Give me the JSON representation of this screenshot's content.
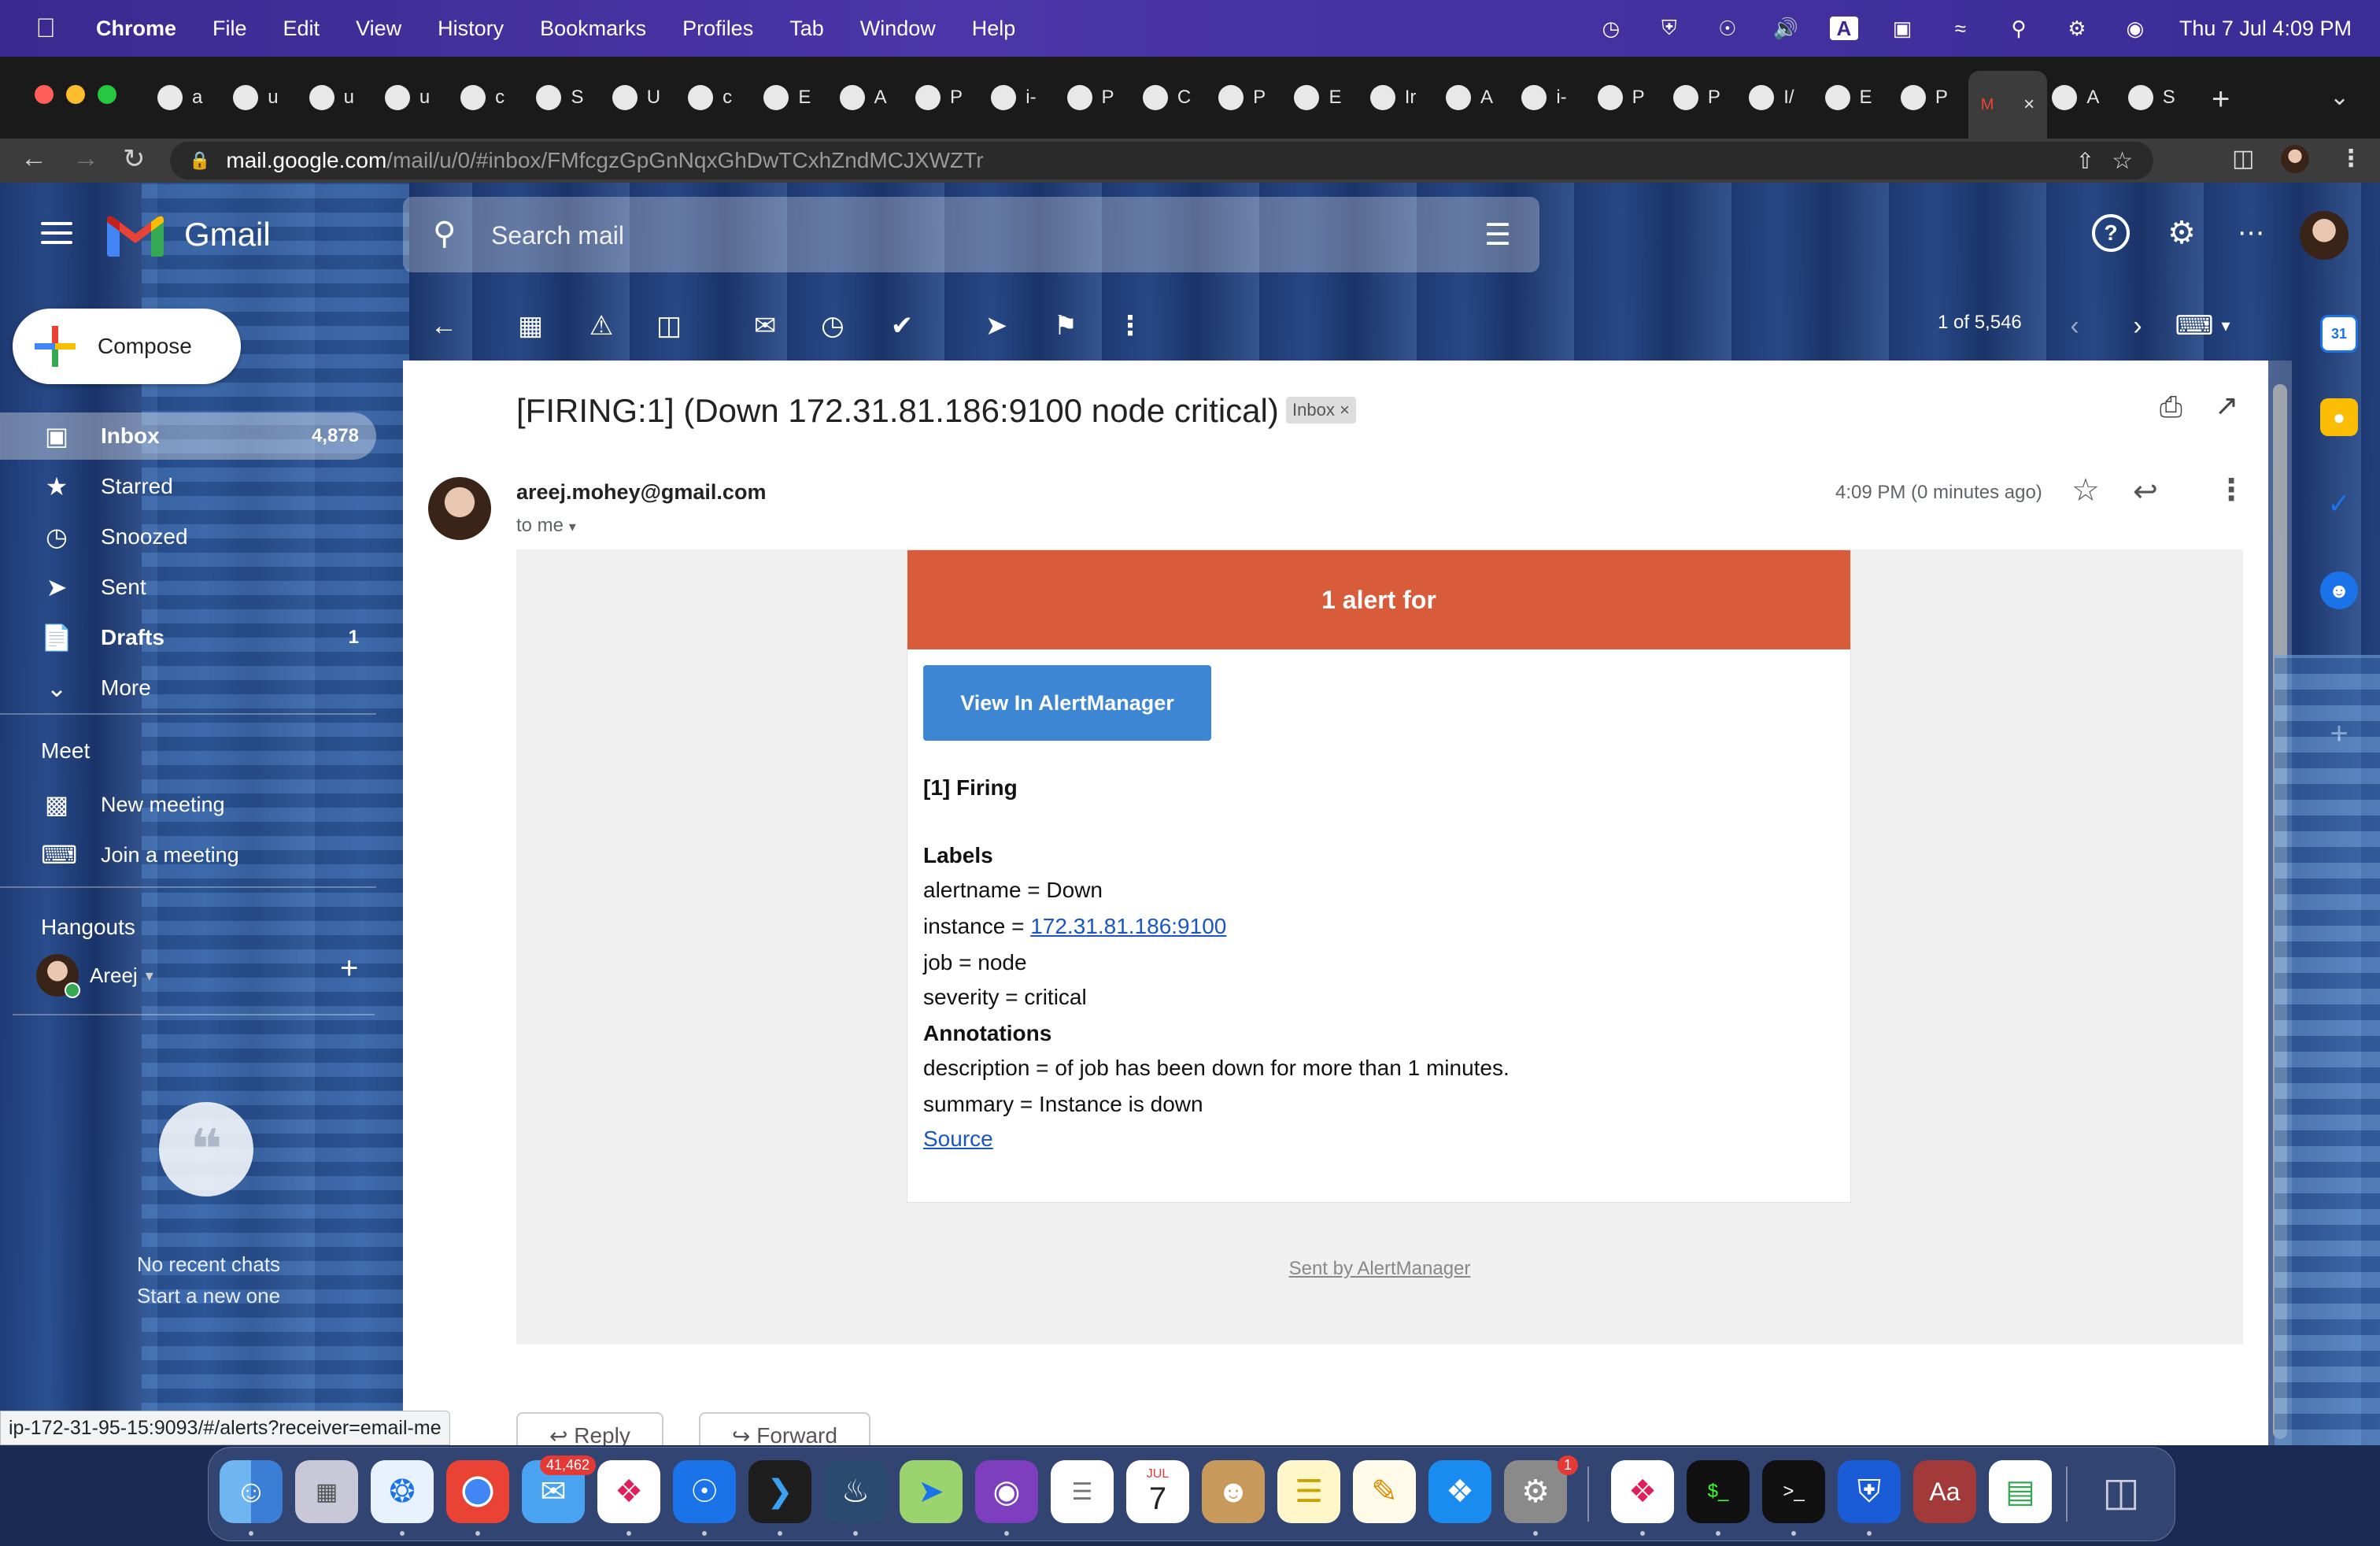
{
  "menubar": {
    "app_name": "Chrome",
    "items": [
      "File",
      "Edit",
      "View",
      "History",
      "Bookmarks",
      "Profiles",
      "Tab",
      "Window",
      "Help"
    ],
    "clock": "Thu 7 Jul  4:09 PM"
  },
  "tabs": [
    {
      "label": "a"
    },
    {
      "label": "u"
    },
    {
      "label": "u"
    },
    {
      "label": "u"
    },
    {
      "label": "c"
    },
    {
      "label": "S"
    },
    {
      "label": "U"
    },
    {
      "label": "c"
    },
    {
      "label": "E"
    },
    {
      "label": "A"
    },
    {
      "label": "P"
    },
    {
      "label": "i-"
    },
    {
      "label": "P"
    },
    {
      "label": "C"
    },
    {
      "label": "P"
    },
    {
      "label": "E"
    },
    {
      "label": "Ir"
    },
    {
      "label": "A"
    },
    {
      "label": "i-"
    },
    {
      "label": "P"
    },
    {
      "label": "P"
    },
    {
      "label": "I/"
    },
    {
      "label": "E"
    },
    {
      "label": "P"
    },
    {
      "label": "",
      "active": true
    },
    {
      "label": "A"
    },
    {
      "label": "S"
    }
  ],
  "omnibox": {
    "host": "mail.google.com",
    "path": "/mail/u/0/#inbox/FMfcgzGpGnNqxGhDwTCxhZndMCJXWZTr"
  },
  "gmail": {
    "wordmark": "Gmail",
    "search_placeholder": "Search mail",
    "compose_label": "Compose",
    "nav": {
      "inbox": {
        "label": "Inbox",
        "count": "4,878"
      },
      "starred": {
        "label": "Starred"
      },
      "snoozed": {
        "label": "Snoozed"
      },
      "sent": {
        "label": "Sent"
      },
      "drafts": {
        "label": "Drafts",
        "count": "1"
      },
      "more": {
        "label": "More"
      }
    },
    "meet": {
      "title": "Meet",
      "new_meeting": "New meeting",
      "join_meeting": "Join a meeting"
    },
    "hangouts": {
      "title": "Hangouts",
      "user": "Areej",
      "no_chats_line1": "No recent chats",
      "no_chats_line2": "Start a new one"
    },
    "page_count": "1 of 5,546"
  },
  "message": {
    "subject": "[FIRING:1] (Down 172.31.81.186:9100 node critical)",
    "label_chip": "Inbox",
    "sender": "areej.mohey@gmail.com",
    "recipient": "to me",
    "time": "4:09 PM (0 minutes ago)",
    "alert_header": "1 alert for",
    "button_label": "View In AlertManager",
    "firing_title": "[1] Firing",
    "labels_title": "Labels",
    "alertname": "alertname = Down",
    "instance_prefix": "instance = ",
    "instance_link": "172.31.81.186:9100",
    "job": "job = node",
    "severity": "severity = critical",
    "annotations_title": "Annotations",
    "description": "description = of job has been down for more than 1 minutes.",
    "summary": "summary = Instance is down",
    "source_link": "Source",
    "sent_by": "Sent by AlertManager",
    "reply_label": "Reply",
    "forward_label": "Forward"
  },
  "status_url": "ip-172-31-95-15:9093/#/alerts?receiver=email-me",
  "dock": {
    "mail_badge": "41,462",
    "calendar_month": "JUL",
    "calendar_day": "7",
    "settings_badge": "1"
  },
  "colors": {
    "alert_header": "#d95c3a",
    "alertmanager_button": "#3c86d4",
    "link": "#1a55c4"
  }
}
